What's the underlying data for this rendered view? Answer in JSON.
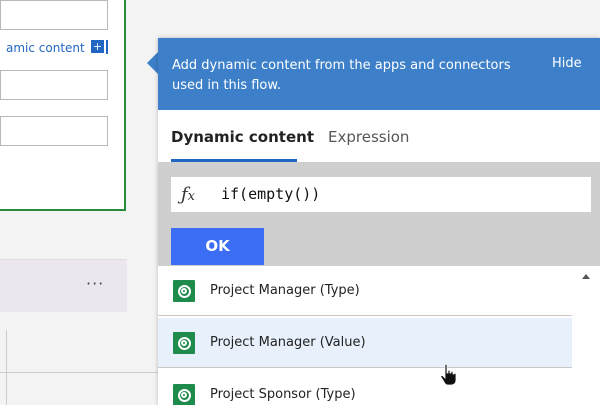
{
  "left_panel": {
    "dynamic_content_link": "amic content",
    "dynamic_content_plus": "+",
    "more_options": "···"
  },
  "dynamic_panel": {
    "header_text": "Add dynamic content from the apps and connectors used in this flow.",
    "hide_label": "Hide",
    "tabs": [
      {
        "label": "Dynamic content",
        "active": true
      },
      {
        "label": "Expression",
        "active": false
      }
    ],
    "expression": {
      "fx_label": "fx",
      "value": "if(empty())"
    },
    "ok_label": "OK",
    "items": [
      {
        "label": "Project Manager (Type)",
        "icon": "dataverse-icon"
      },
      {
        "label": "Project Manager (Value)",
        "icon": "dataverse-icon",
        "hover": true
      },
      {
        "label": "Project Sponsor (Type)",
        "icon": "dataverse-icon"
      }
    ]
  },
  "colors": {
    "header_bg": "#3d80c9",
    "ok_button": "#3b6ef5",
    "tab_underline": "#2266c4",
    "card_border": "#2a8a3c",
    "icon_green": "#1e8a4c"
  }
}
